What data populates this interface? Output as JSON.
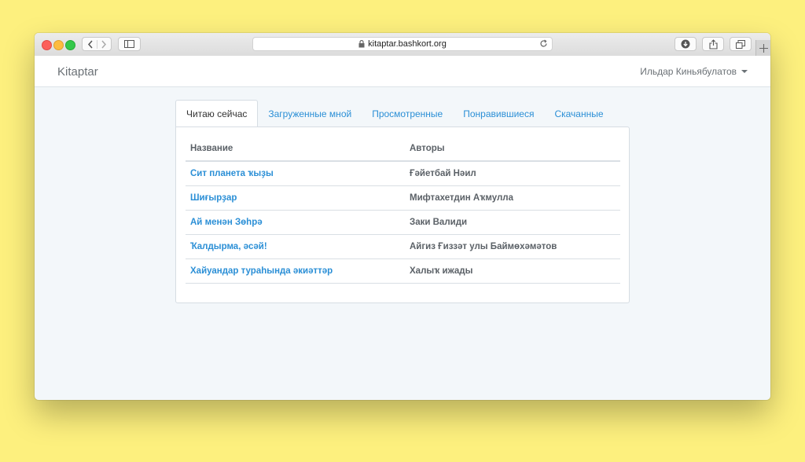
{
  "browser": {
    "url": "kitaptar.bashkort.org"
  },
  "navbar": {
    "brand": "Kitaptar",
    "user_name": "Ильдар Киньябулатов"
  },
  "tabs": [
    {
      "label": "Читаю сейчас",
      "active": true
    },
    {
      "label": "Загруженные мной",
      "active": false
    },
    {
      "label": "Просмотренные",
      "active": false
    },
    {
      "label": "Понравившиеся",
      "active": false
    },
    {
      "label": "Скачанные",
      "active": false
    }
  ],
  "table": {
    "headers": [
      "Название",
      "Авторы"
    ],
    "rows": [
      {
        "title": "Сит планета ҡыҙы",
        "author": "Ғәйетбай Нәил"
      },
      {
        "title": "Шиғырҙар",
        "author": "Мифтахетдин Аҡмулла"
      },
      {
        "title": "Ай менән Зөһрә",
        "author": "Заки Валиди"
      },
      {
        "title": "Ҡалдырма, әсәй!",
        "author": "Айгиз Ғиззәт улы Баймөхәмәтов"
      },
      {
        "title": "Хайуандар тураһында әкиәттәр",
        "author": "Халыҡ ижады"
      }
    ]
  },
  "colors": {
    "desktop": "#fdf07e",
    "link": "#2b8fd6"
  }
}
